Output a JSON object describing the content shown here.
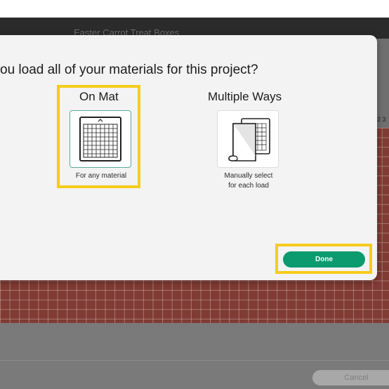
{
  "app": {
    "project_title": "Easter Carrot Treat Boxes",
    "ruler_partial": "2 3"
  },
  "dialog": {
    "question": "ou load all of your materials for this project?",
    "options": [
      {
        "title": "On Mat",
        "description": "For any material",
        "icon": "cutting-mat-icon",
        "selected": true
      },
      {
        "title": "Multiple Ways",
        "description_line1": "Manually select",
        "description_line2": "for each load",
        "icon": "mat-and-roll-icon",
        "selected": false
      }
    ],
    "done_label": "Done"
  },
  "footer": {
    "cancel_label": "Cancel"
  },
  "colors": {
    "accent": "#0c9b6e",
    "highlight": "#f5cc1b",
    "selected_border": "#5aa99b",
    "mat": "#7f3b34"
  }
}
